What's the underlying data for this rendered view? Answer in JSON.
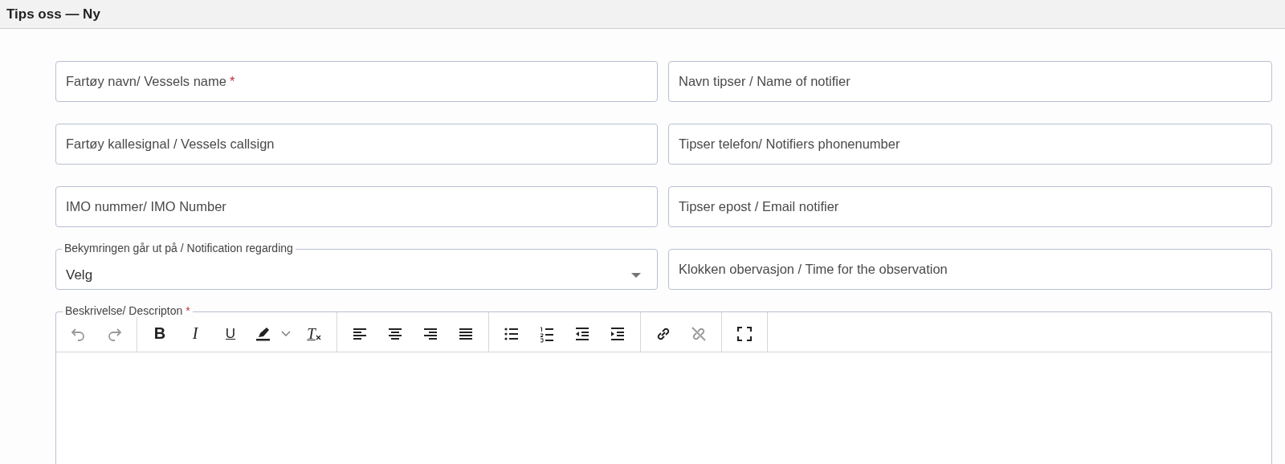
{
  "window": {
    "title": "Tips oss — Ny"
  },
  "fields": [
    {
      "kind": "text",
      "label": "Fartøy navn/ Vessels name",
      "required_mark": "*"
    },
    {
      "kind": "text",
      "label": "Navn tipser / Name of notifier"
    },
    {
      "kind": "text",
      "label": "Fartøy kallesignal / Vessels callsign"
    },
    {
      "kind": "text",
      "label": "Tipser telefon/ Notifiers phonenumber"
    },
    {
      "kind": "text",
      "label": "IMO nummer/ IMO Number"
    },
    {
      "kind": "text",
      "label": "Tipser epost / Email notifier"
    },
    {
      "kind": "select",
      "label": "Bekymringen går ut på / Notification regarding",
      "value": "Velg"
    },
    {
      "kind": "text",
      "label": "Klokken obervasjon / Time for the observation"
    }
  ],
  "editor": {
    "label": "Beskrivelse/ Descripton",
    "required_mark": "*",
    "toolbar": [
      [
        {
          "kind": "undo",
          "disabled": true
        },
        {
          "kind": "redo",
          "disabled": true
        }
      ],
      [
        {
          "kind": "bold",
          "glyph": "B",
          "disabled": false
        },
        {
          "kind": "italic",
          "glyph": "I",
          "disabled": false
        },
        {
          "kind": "underline",
          "glyph": "U",
          "disabled": false
        },
        {
          "kind": "highlight",
          "disabled": false
        },
        {
          "kind": "clear-format",
          "glyph": "T",
          "disabled": false
        }
      ],
      [
        {
          "kind": "align-left",
          "disabled": false
        },
        {
          "kind": "align-center",
          "disabled": false
        },
        {
          "kind": "align-right",
          "disabled": false
        },
        {
          "kind": "justify",
          "disabled": false
        }
      ],
      [
        {
          "kind": "bullet-list",
          "disabled": false
        },
        {
          "kind": "numbered-list",
          "disabled": false
        },
        {
          "kind": "outdent",
          "disabled": false
        },
        {
          "kind": "indent",
          "disabled": false
        }
      ],
      [
        {
          "kind": "link",
          "disabled": false
        },
        {
          "kind": "unlink",
          "disabled": true
        }
      ],
      [
        {
          "kind": "fullscreen",
          "disabled": false
        }
      ]
    ]
  }
}
